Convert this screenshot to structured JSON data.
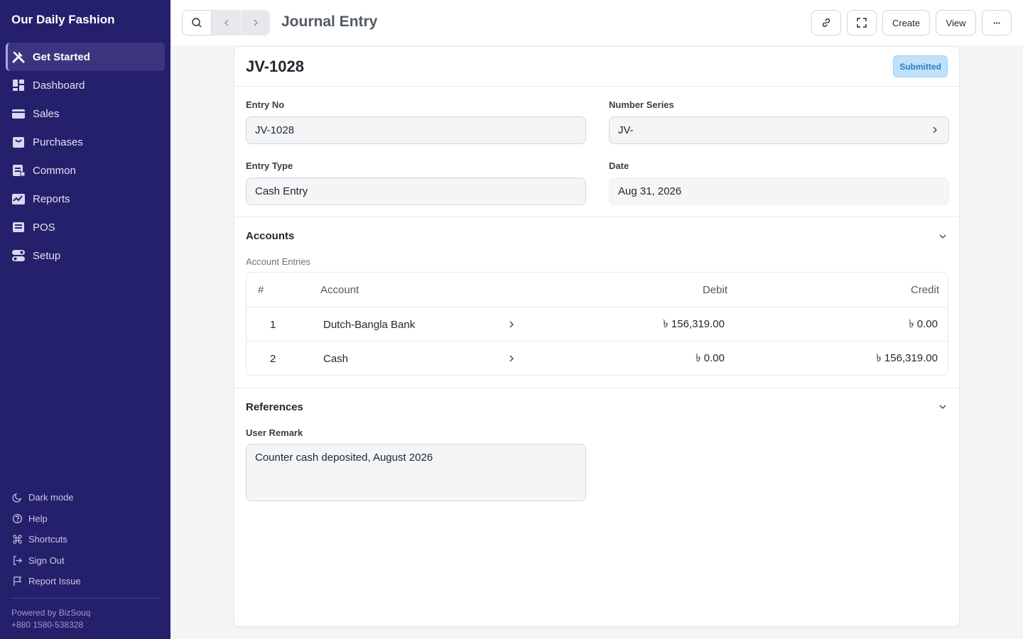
{
  "sidebar": {
    "brand": "Our Daily Fashion",
    "items": [
      {
        "label": "Get Started",
        "icon": "tools-icon"
      },
      {
        "label": "Dashboard",
        "icon": "dashboard-icon"
      },
      {
        "label": "Sales",
        "icon": "sales-icon"
      },
      {
        "label": "Purchases",
        "icon": "purchases-icon"
      },
      {
        "label": "Common",
        "icon": "common-icon"
      },
      {
        "label": "Reports",
        "icon": "reports-icon"
      },
      {
        "label": "POS",
        "icon": "pos-icon"
      },
      {
        "label": "Setup",
        "icon": "setup-icon"
      }
    ],
    "bottom": [
      {
        "label": "Dark mode",
        "icon": "moon-icon"
      },
      {
        "label": "Help",
        "icon": "help-icon"
      },
      {
        "label": "Shortcuts",
        "icon": "command-icon"
      },
      {
        "label": "Sign Out",
        "icon": "sign-out-icon"
      },
      {
        "label": "Report Issue",
        "icon": "flag-icon"
      }
    ],
    "powered_by": "Powered by BizSouq",
    "phone": "+880 1580-538328"
  },
  "header": {
    "title": "Journal Entry",
    "create_label": "Create",
    "view_label": "View",
    "more_label": "···"
  },
  "doc": {
    "name": "JV-1028",
    "status": "Submitted",
    "entry_no_label": "Entry No",
    "entry_no": "JV-1028",
    "number_series_label": "Number Series",
    "number_series": "JV-",
    "entry_type_label": "Entry Type",
    "entry_type": "Cash Entry",
    "date_label": "Date",
    "date": "Aug 31, 2026"
  },
  "accounts": {
    "title": "Accounts",
    "sub_label": "Account Entries",
    "columns": [
      "#",
      "Account",
      "Debit",
      "Credit"
    ],
    "rows": [
      {
        "idx": "1",
        "account": "Dutch-Bangla Bank",
        "debit": "৳ 156,319.00",
        "credit": "৳ 0.00"
      },
      {
        "idx": "2",
        "account": "Cash",
        "debit": "৳ 0.00",
        "credit": "৳ 156,319.00"
      }
    ]
  },
  "references": {
    "title": "References",
    "user_remark_label": "User Remark",
    "user_remark": "Counter cash deposited, August 2026"
  },
  "colors": {
    "sidebar_bg": "#25206b",
    "badge_bg": "#bfe1fb",
    "badge_text": "#2e7bbf"
  }
}
